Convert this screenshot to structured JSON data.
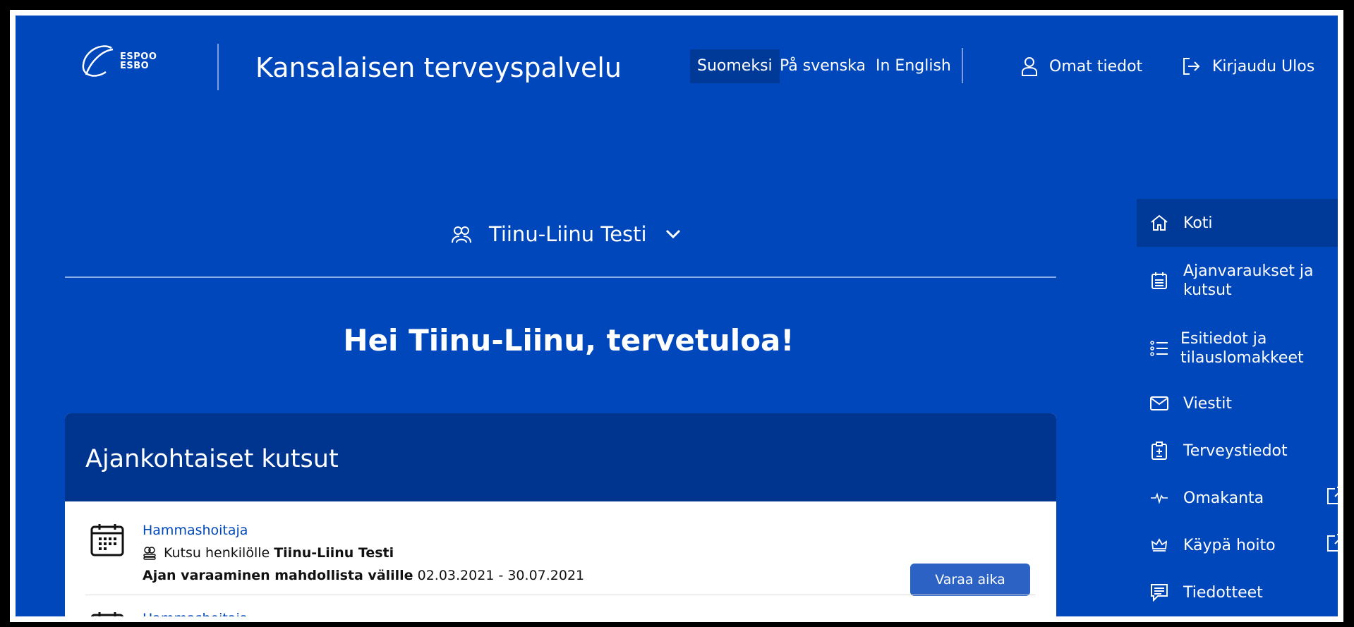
{
  "header": {
    "logo_text_1": "ESPOO",
    "logo_text_2": "ESBO",
    "title": "Kansalaisen terveyspalvelu",
    "languages": [
      "Suomeksi",
      "På svenska",
      "In English"
    ],
    "active_language": "Suomeksi",
    "profile_label": "Omat tiedot",
    "logout_label": "Kirjaudu Ulos"
  },
  "person_selector": {
    "name": "Tiinu-Liinu Testi"
  },
  "greeting": "Hei Tiinu-Liinu, tervetuloa!",
  "invitations": {
    "title": "Ajankohtaiset kutsut",
    "items": [
      {
        "name": "Hammashoitaja",
        "invite_prefix": "Kutsu henkilölle",
        "invite_person": "Tiinu-Liinu Testi",
        "period_label": "Ajan varaaminen mahdollista välille",
        "period_dates": "02.03.2021 - 30.07.2021",
        "button": "Varaa aika"
      },
      {
        "name": "Hammashoitaja"
      }
    ]
  },
  "sidenav": {
    "items": [
      {
        "label": "Koti",
        "icon": "home-icon",
        "active": true
      },
      {
        "label_line1": "Ajanvaraukset ja",
        "label_line2": "kutsut",
        "icon": "calendar-icon"
      },
      {
        "label_line1": "Esitiedot ja",
        "label_line2": "tilauslomakkeet",
        "icon": "list-icon"
      },
      {
        "label": "Viestit",
        "icon": "envelope-icon"
      },
      {
        "label": "Terveystiedot",
        "icon": "clipboard-icon"
      },
      {
        "label": "Omakanta",
        "icon": "pulse-icon",
        "external": true
      },
      {
        "label": "Käypä hoito",
        "icon": "crown-icon",
        "external": true
      },
      {
        "label": "Tiedotteet",
        "icon": "chat-icon"
      }
    ]
  },
  "colors": {
    "brand_blue": "#0047bb",
    "dark_blue": "#00358f",
    "button_blue": "#2b62c4"
  }
}
